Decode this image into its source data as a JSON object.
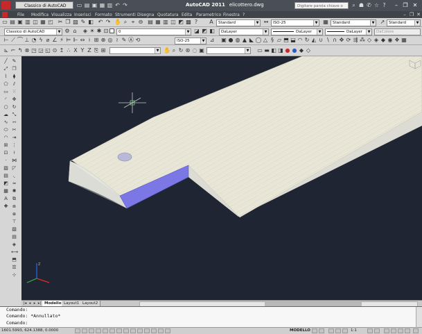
{
  "app": {
    "title": "AutoCAD 2011",
    "document": "elicottero.dwg",
    "workspace": "Classico di AutoCAD",
    "search_placeholder": "Digitare parola chiave o frase",
    "brand_color": "#c8282a"
  },
  "window_controls": {
    "minimize": "–",
    "restore": "❐",
    "close": "✕"
  },
  "menu": {
    "items": [
      "File",
      "Modifica",
      "Visualizza",
      "Inserisci",
      "Formato",
      "Strumenti",
      "Disegna",
      "Quotatura",
      "Edita",
      "Parametrico",
      "Finestra",
      "?"
    ]
  },
  "toolbar": {
    "text_style": "Standard",
    "dim_style": "ISO-25",
    "table_style": "Standard",
    "multileader_style": "Standard",
    "workspace_select": "Classico di AutoCAD",
    "layer": "0",
    "color": "DaLayer",
    "linetype": "DaLayer",
    "lineweight": "DaLayer",
    "plotstyle": "DaColore",
    "dim_style_2": "ISO-25"
  },
  "viewport": {
    "background": "#1f2532",
    "cut_face_color": "#7b78e6",
    "wood_color": "#e8e6d6"
  },
  "layout_tabs": [
    "Modello",
    "Layout1",
    "Layout2"
  ],
  "command_lines": [
    "Comando:",
    "Comando: *Annullato*",
    "Comando:"
  ],
  "status": {
    "coordinates": "1601.5993, 624.1388, 0.0000",
    "space": "MODELLO",
    "annotation_scale": "1:1"
  }
}
